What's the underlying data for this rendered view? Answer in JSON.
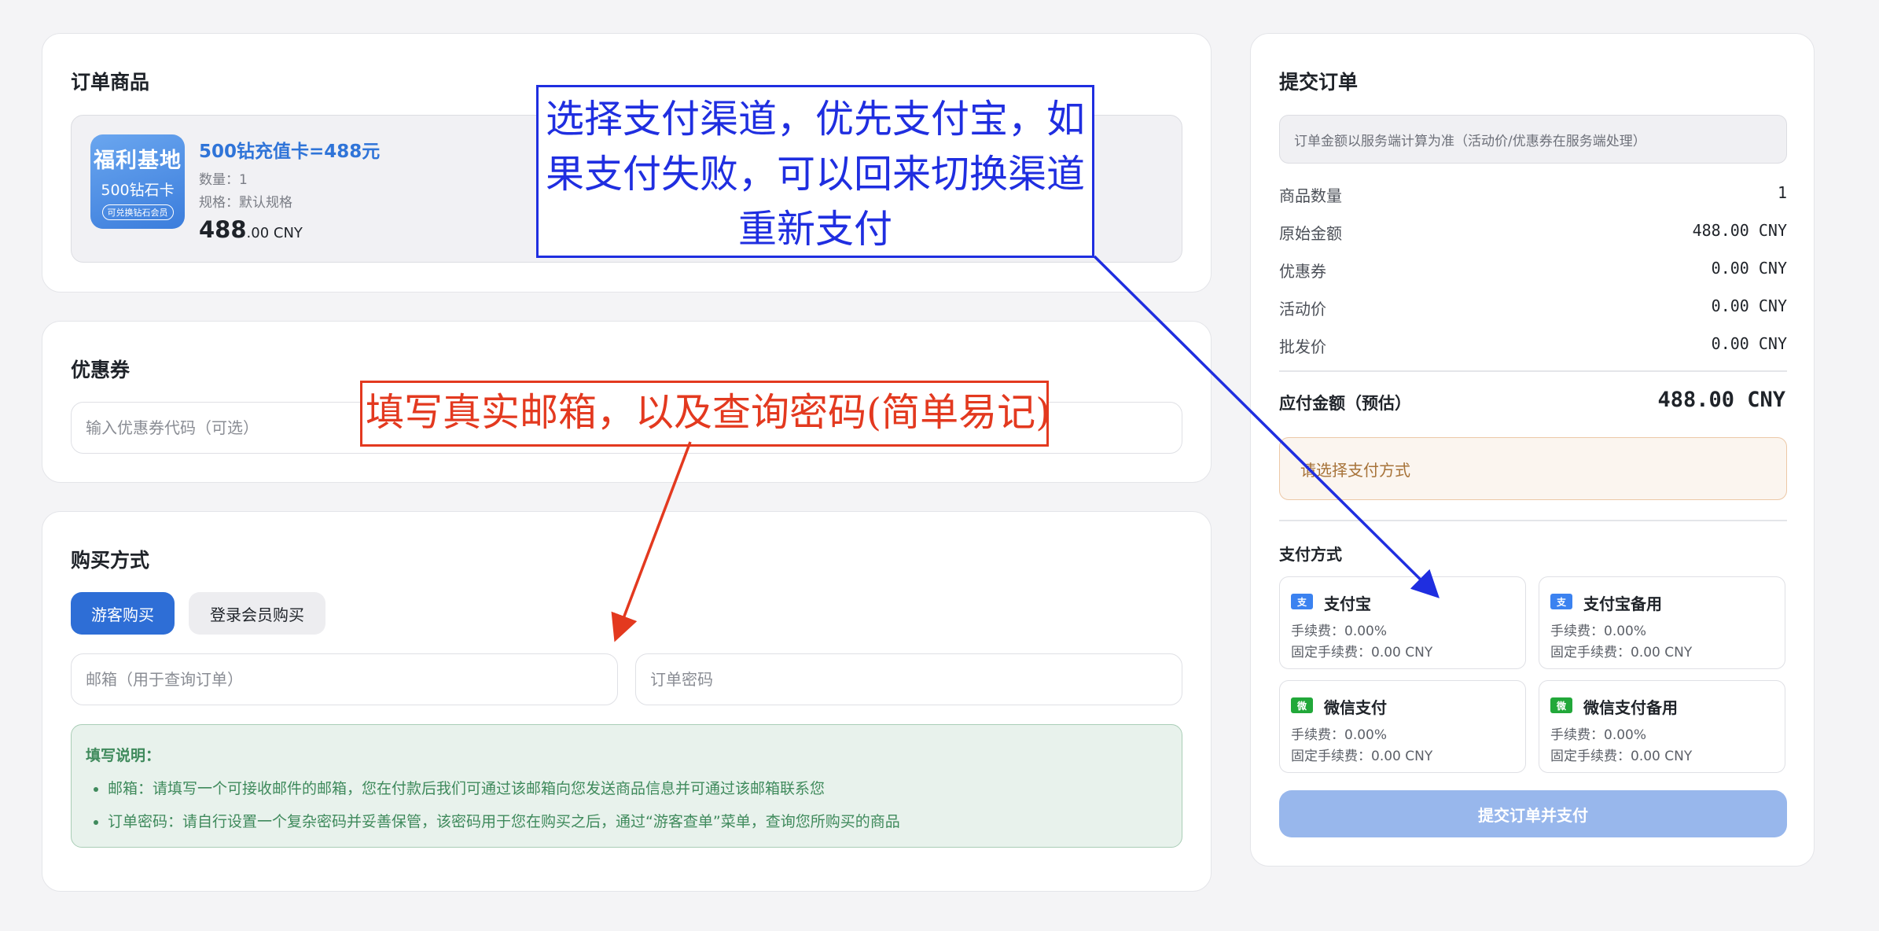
{
  "order_items": {
    "title": "订单商品",
    "product": {
      "thumb_line1": "福利基地",
      "thumb_line2": "500钻石卡",
      "thumb_line3": "可兑换钻石会员",
      "name": "500钻充值卡=488元",
      "quantity": "数量：1",
      "spec": "规格：默认规格",
      "price_int": "488",
      "price_dec": ".00 CNY"
    }
  },
  "coupon": {
    "title": "优惠券",
    "placeholder": "输入优惠券代码（可选）"
  },
  "purchase": {
    "title": "购买方式",
    "tab_guest": "游客购买",
    "tab_member": "登录会员购买",
    "email_placeholder": "邮箱（用于查询订单）",
    "password_placeholder": "订单密码",
    "notes_title": "填写说明：",
    "notes": [
      "邮箱：请填写一个可接收邮件的邮箱，您在付款后我们可通过该邮箱向您发送商品信息并可通过该邮箱联系您",
      "订单密码：请自行设置一个复杂密码并妥善保管，该密码用于您在购买之后，通过“游客查单”菜单，查询您所购买的商品"
    ]
  },
  "summary": {
    "title": "提交订单",
    "notice": "订单金额以服务端计算为准（活动价/优惠券在服务端处理）",
    "rows": [
      {
        "label": "商品数量",
        "value": "1"
      },
      {
        "label": "原始金额",
        "value": "488.00 CNY"
      },
      {
        "label": "优惠券",
        "value": "0.00 CNY"
      },
      {
        "label": "活动价",
        "value": "0.00 CNY"
      },
      {
        "label": "批发价",
        "value": "0.00 CNY"
      }
    ],
    "total_label": "应付金额（预估）",
    "total_value": "488.00 CNY",
    "warning": "请选择支付方式",
    "payment_title": "支付方式",
    "payment_methods": [
      {
        "name": "支付宝",
        "fee": "手续费：0.00%",
        "fixed_fee": "固定手续费：0.00 CNY",
        "icon": "alipay-icon"
      },
      {
        "name": "支付宝备用",
        "fee": "手续费：0.00%",
        "fixed_fee": "固定手续费：0.00 CNY",
        "icon": "alipay-icon"
      },
      {
        "name": "微信支付",
        "fee": "手续费：0.00%",
        "fixed_fee": "固定手续费：0.00 CNY",
        "icon": "wechat-pay-icon"
      },
      {
        "name": "微信支付备用",
        "fee": "手续费：0.00%",
        "fixed_fee": "固定手续费：0.00 CNY",
        "icon": "wechat-pay-icon"
      }
    ],
    "submit_label": "提交订单并支付"
  },
  "annotations": {
    "blue_text": "选择支付渠道，优先支付宝，如果支付失败，可以回来切换渠道重新支付",
    "red_text": "填写真实邮箱，以及查询密码(简单易记)",
    "blue_color": "#1f2ee0",
    "red_color": "#e3391f"
  },
  "colors": {
    "primary": "#2e6ed6",
    "submit_disabled": "#98b7ec",
    "notes_green": "#3f8a5c",
    "warning_text": "#a77339"
  }
}
